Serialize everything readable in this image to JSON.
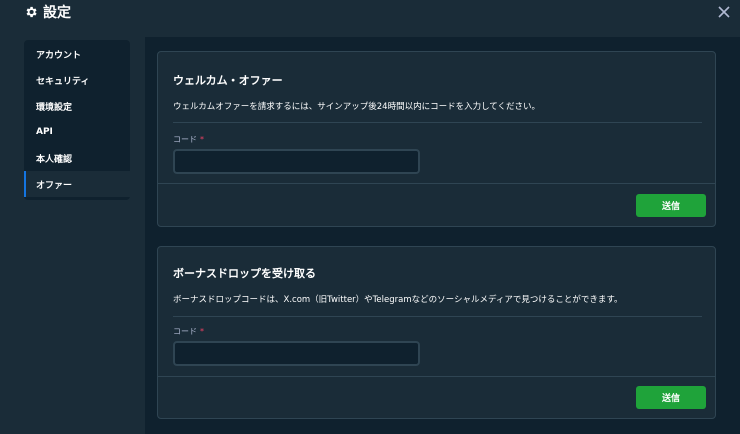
{
  "header": {
    "title": "設定",
    "icon": "gear-icon",
    "close_icon": "close-icon"
  },
  "sidebar": {
    "items": [
      {
        "label": "アカウント",
        "active": false
      },
      {
        "label": "セキュリティ",
        "active": false
      },
      {
        "label": "環境設定",
        "active": false
      },
      {
        "label": "API",
        "active": false
      },
      {
        "label": "本人確認",
        "active": false
      },
      {
        "label": "オファー",
        "active": true
      }
    ]
  },
  "welcome_offer": {
    "title": "ウェルカム・オファー",
    "description": "ウェルカムオファーを請求するには、サインアップ後24時間以内にコードを入力してください。",
    "field_label": "コード",
    "required_mark": "*",
    "input_value": "",
    "submit_label": "送信"
  },
  "bonus_drop": {
    "title": "ボーナスドロップを受け取る",
    "description": "ボーナスドロップコードは、X.com（旧Twitter）やTelegramなどのソーシャルメディアで見つけることができます。",
    "field_label": "コード",
    "required_mark": "*",
    "input_value": "",
    "submit_label": "送信"
  },
  "colors": {
    "background": "#1a2c38",
    "panel": "#0f212e",
    "border": "#2f4553",
    "accent_blue": "#1475e1",
    "button_green": "#1fa33a",
    "required_red": "#ed4163"
  }
}
